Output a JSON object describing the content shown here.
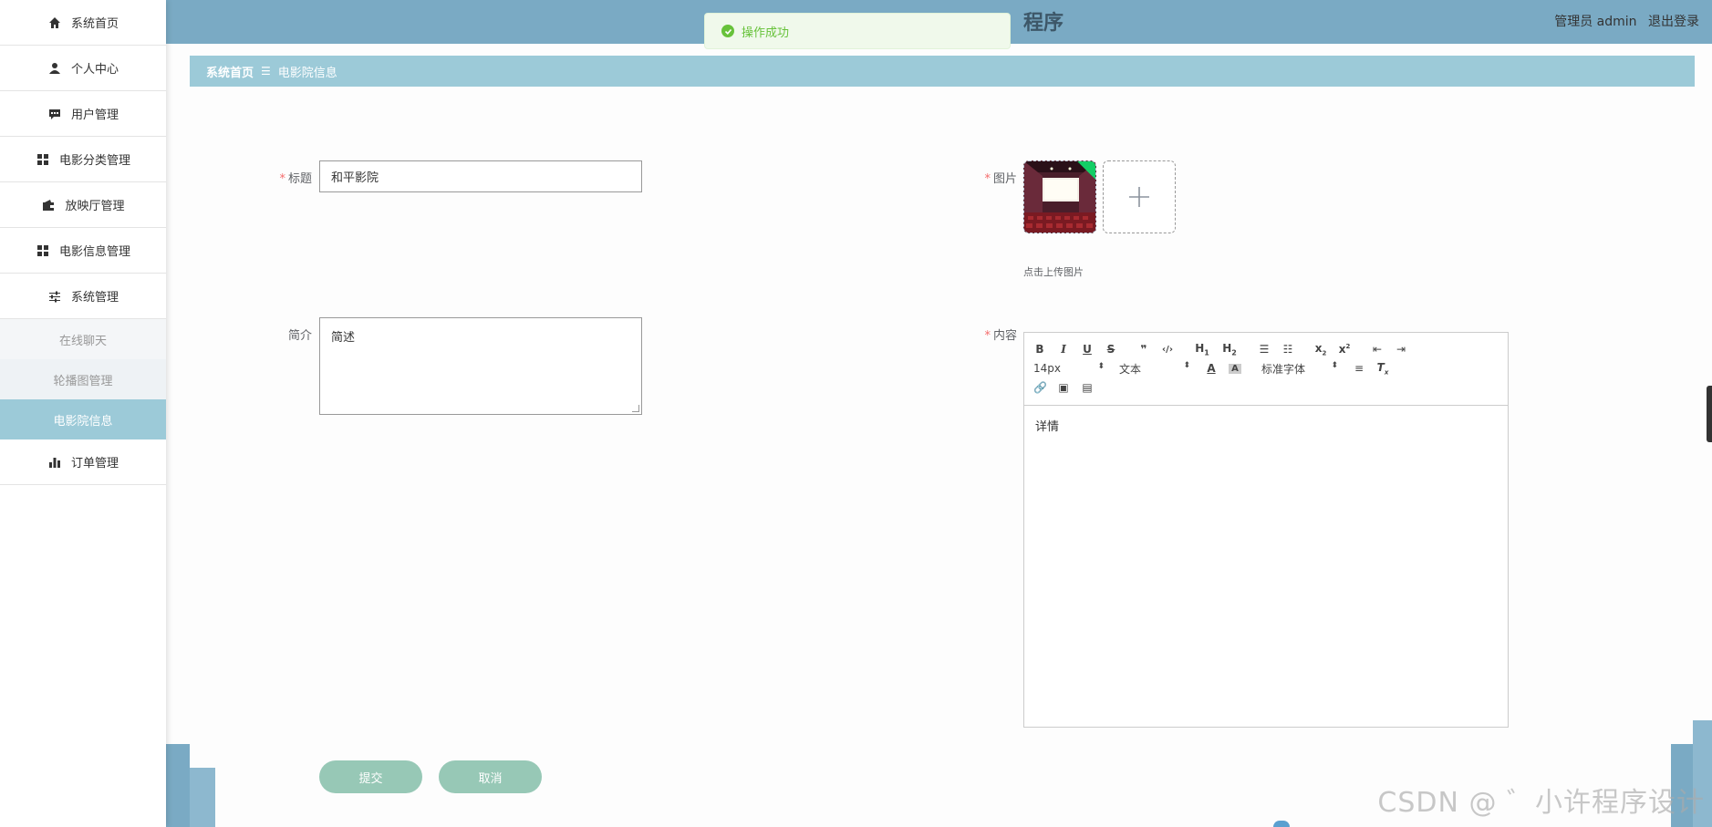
{
  "header": {
    "title": "程序",
    "user_label": "管理员 admin",
    "logout_label": "退出登录"
  },
  "toast": {
    "message": "操作成功"
  },
  "sidebar": {
    "items": [
      {
        "label": "系统首页",
        "icon": "home-icon"
      },
      {
        "label": "个人中心",
        "icon": "user-icon"
      },
      {
        "label": "用户管理",
        "icon": "chat-icon"
      },
      {
        "label": "电影分类管理",
        "icon": "grid-icon"
      },
      {
        "label": "放映厅管理",
        "icon": "wallet-icon"
      },
      {
        "label": "电影信息管理",
        "icon": "grid-icon"
      },
      {
        "label": "系统管理",
        "icon": "sliders-icon"
      }
    ],
    "sub_items": [
      {
        "label": "在线聊天"
      },
      {
        "label": "轮播图管理"
      },
      {
        "label": "电影院信息"
      }
    ],
    "last_item": {
      "label": "订单管理",
      "icon": "bar-chart-icon"
    }
  },
  "breadcrumb": {
    "home": "系统首页",
    "current": "电影院信息"
  },
  "form": {
    "title_label": "标题",
    "title_value": "和平影院",
    "intro_label": "简介",
    "intro_value": "简述",
    "image_label": "图片",
    "image_hint": "点击上传图片",
    "content_label": "内容",
    "content_value": "详情",
    "editor_font_size": "14px",
    "editor_text_type": "文本",
    "editor_font_family": "标准字体",
    "submit_label": "提交",
    "cancel_label": "取消"
  },
  "watermark": "CSDN @ ゛小许程序设计"
}
